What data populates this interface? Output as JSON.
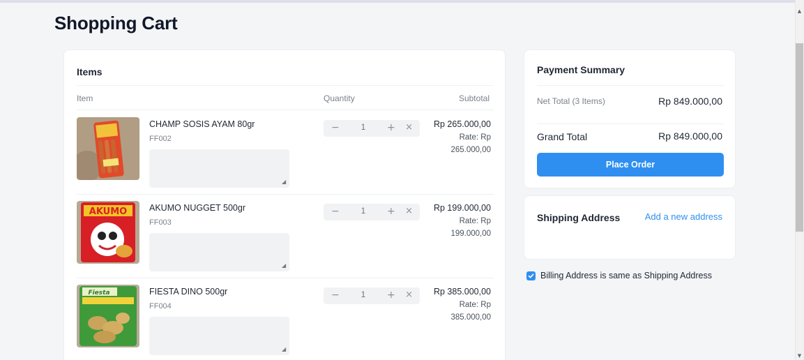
{
  "page": {
    "title": "Shopping Cart"
  },
  "items_card": {
    "title": "Items",
    "columns": {
      "item": "Item",
      "quantity": "Quantity",
      "subtotal": "Subtotal"
    },
    "items": [
      {
        "name": "CHAMP SOSIS AYAM 80gr",
        "code": "FF002",
        "qty": "1",
        "subtotal": "Rp 265.000,00",
        "rate_label": "Rate: Rp",
        "rate_value": "265.000,00",
        "image": "product-photo-sausage-icon"
      },
      {
        "name": "AKUMO NUGGET 500gr",
        "code": "FF003",
        "qty": "1",
        "subtotal": "Rp 199.000,00",
        "rate_label": "Rate: Rp",
        "rate_value": "199.000,00",
        "image": "product-photo-nugget-icon"
      },
      {
        "name": "FIESTA DINO 500gr",
        "code": "FF004",
        "qty": "1",
        "subtotal": "Rp 385.000,00",
        "rate_label": "Rate: Rp",
        "rate_value": "385.000,00",
        "image": "product-photo-dino-icon"
      }
    ]
  },
  "summary": {
    "title": "Payment Summary",
    "net_label": "Net Total (3 Items)",
    "net_value": "Rp 849.000,00",
    "grand_label": "Grand Total",
    "grand_value": "Rp 849.000,00",
    "place_order": "Place Order"
  },
  "shipping": {
    "title": "Shipping Address",
    "add_link": "Add a new address"
  },
  "billing": {
    "label": "Billing Address is same as Shipping Address",
    "checked": true
  },
  "colors": {
    "accent": "#2f8ff0",
    "background": "#f4f5f7",
    "card": "#ffffff",
    "text": "#1f2733",
    "muted": "#7b818b"
  }
}
